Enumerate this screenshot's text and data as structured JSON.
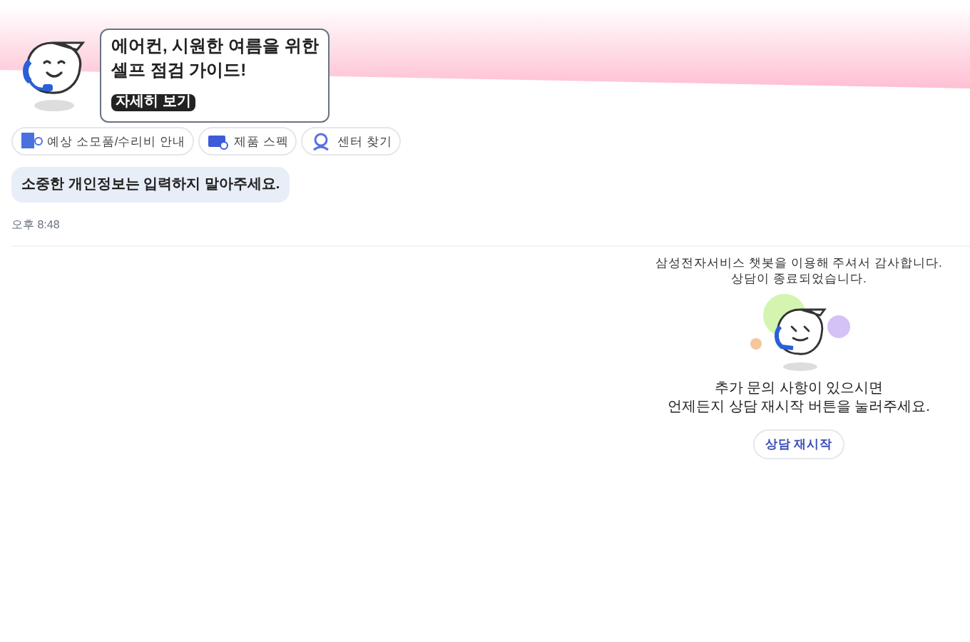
{
  "promo": {
    "title_lines": [
      "에어컨, 시원한 여름을 위한",
      "셀프 점검 가이드!"
    ],
    "link": "자세히 보기"
  },
  "quick_menu": [
    {
      "kind": "cost",
      "label": "예상 소모품/수리비 안내"
    },
    {
      "kind": "spec",
      "label": "제품 스펙"
    },
    {
      "kind": "center",
      "label": "센터 찾기"
    }
  ],
  "notice": "소중한 개인정보는 입력하지 말아주세요.",
  "time": "오후 8:48",
  "end_message": {
    "thanks_lines": [
      "삼성전자서비스 챗봇을 이용해 주셔서 감사합니다.",
      "상담이 종료되었습니다."
    ],
    "info_lines": [
      "추가 문의 사항이 있으시면",
      "언제든지 상담 재시작 버튼을 눌러주세요."
    ],
    "button": "상담 재시작"
  }
}
